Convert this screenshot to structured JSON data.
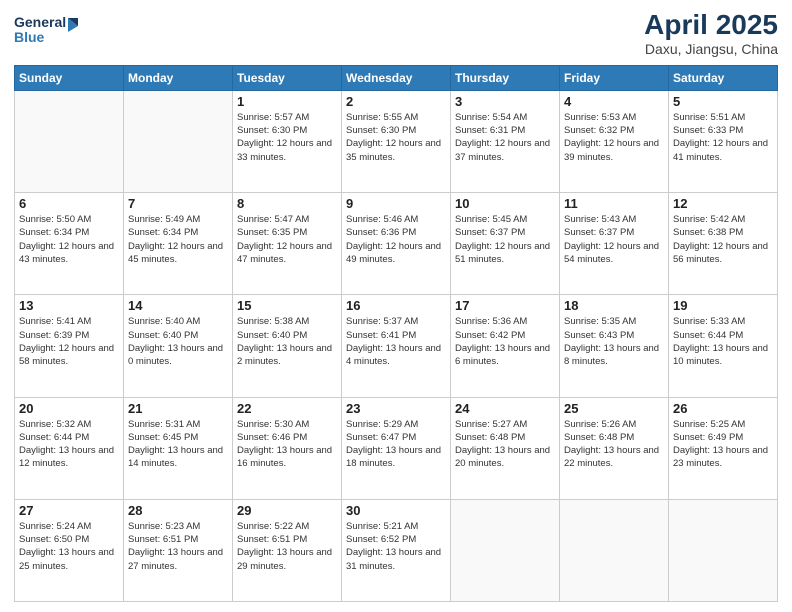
{
  "logo": {
    "line1": "General",
    "line2": "Blue"
  },
  "title": "April 2025",
  "subtitle": "Daxu, Jiangsu, China",
  "days": [
    "Sunday",
    "Monday",
    "Tuesday",
    "Wednesday",
    "Thursday",
    "Friday",
    "Saturday"
  ],
  "weeks": [
    [
      {
        "day": "",
        "sunrise": "",
        "sunset": "",
        "daylight": ""
      },
      {
        "day": "",
        "sunrise": "",
        "sunset": "",
        "daylight": ""
      },
      {
        "day": "1",
        "sunrise": "Sunrise: 5:57 AM",
        "sunset": "Sunset: 6:30 PM",
        "daylight": "Daylight: 12 hours and 33 minutes."
      },
      {
        "day": "2",
        "sunrise": "Sunrise: 5:55 AM",
        "sunset": "Sunset: 6:30 PM",
        "daylight": "Daylight: 12 hours and 35 minutes."
      },
      {
        "day": "3",
        "sunrise": "Sunrise: 5:54 AM",
        "sunset": "Sunset: 6:31 PM",
        "daylight": "Daylight: 12 hours and 37 minutes."
      },
      {
        "day": "4",
        "sunrise": "Sunrise: 5:53 AM",
        "sunset": "Sunset: 6:32 PM",
        "daylight": "Daylight: 12 hours and 39 minutes."
      },
      {
        "day": "5",
        "sunrise": "Sunrise: 5:51 AM",
        "sunset": "Sunset: 6:33 PM",
        "daylight": "Daylight: 12 hours and 41 minutes."
      }
    ],
    [
      {
        "day": "6",
        "sunrise": "Sunrise: 5:50 AM",
        "sunset": "Sunset: 6:34 PM",
        "daylight": "Daylight: 12 hours and 43 minutes."
      },
      {
        "day": "7",
        "sunrise": "Sunrise: 5:49 AM",
        "sunset": "Sunset: 6:34 PM",
        "daylight": "Daylight: 12 hours and 45 minutes."
      },
      {
        "day": "8",
        "sunrise": "Sunrise: 5:47 AM",
        "sunset": "Sunset: 6:35 PM",
        "daylight": "Daylight: 12 hours and 47 minutes."
      },
      {
        "day": "9",
        "sunrise": "Sunrise: 5:46 AM",
        "sunset": "Sunset: 6:36 PM",
        "daylight": "Daylight: 12 hours and 49 minutes."
      },
      {
        "day": "10",
        "sunrise": "Sunrise: 5:45 AM",
        "sunset": "Sunset: 6:37 PM",
        "daylight": "Daylight: 12 hours and 51 minutes."
      },
      {
        "day": "11",
        "sunrise": "Sunrise: 5:43 AM",
        "sunset": "Sunset: 6:37 PM",
        "daylight": "Daylight: 12 hours and 54 minutes."
      },
      {
        "day": "12",
        "sunrise": "Sunrise: 5:42 AM",
        "sunset": "Sunset: 6:38 PM",
        "daylight": "Daylight: 12 hours and 56 minutes."
      }
    ],
    [
      {
        "day": "13",
        "sunrise": "Sunrise: 5:41 AM",
        "sunset": "Sunset: 6:39 PM",
        "daylight": "Daylight: 12 hours and 58 minutes."
      },
      {
        "day": "14",
        "sunrise": "Sunrise: 5:40 AM",
        "sunset": "Sunset: 6:40 PM",
        "daylight": "Daylight: 13 hours and 0 minutes."
      },
      {
        "day": "15",
        "sunrise": "Sunrise: 5:38 AM",
        "sunset": "Sunset: 6:40 PM",
        "daylight": "Daylight: 13 hours and 2 minutes."
      },
      {
        "day": "16",
        "sunrise": "Sunrise: 5:37 AM",
        "sunset": "Sunset: 6:41 PM",
        "daylight": "Daylight: 13 hours and 4 minutes."
      },
      {
        "day": "17",
        "sunrise": "Sunrise: 5:36 AM",
        "sunset": "Sunset: 6:42 PM",
        "daylight": "Daylight: 13 hours and 6 minutes."
      },
      {
        "day": "18",
        "sunrise": "Sunrise: 5:35 AM",
        "sunset": "Sunset: 6:43 PM",
        "daylight": "Daylight: 13 hours and 8 minutes."
      },
      {
        "day": "19",
        "sunrise": "Sunrise: 5:33 AM",
        "sunset": "Sunset: 6:44 PM",
        "daylight": "Daylight: 13 hours and 10 minutes."
      }
    ],
    [
      {
        "day": "20",
        "sunrise": "Sunrise: 5:32 AM",
        "sunset": "Sunset: 6:44 PM",
        "daylight": "Daylight: 13 hours and 12 minutes."
      },
      {
        "day": "21",
        "sunrise": "Sunrise: 5:31 AM",
        "sunset": "Sunset: 6:45 PM",
        "daylight": "Daylight: 13 hours and 14 minutes."
      },
      {
        "day": "22",
        "sunrise": "Sunrise: 5:30 AM",
        "sunset": "Sunset: 6:46 PM",
        "daylight": "Daylight: 13 hours and 16 minutes."
      },
      {
        "day": "23",
        "sunrise": "Sunrise: 5:29 AM",
        "sunset": "Sunset: 6:47 PM",
        "daylight": "Daylight: 13 hours and 18 minutes."
      },
      {
        "day": "24",
        "sunrise": "Sunrise: 5:27 AM",
        "sunset": "Sunset: 6:48 PM",
        "daylight": "Daylight: 13 hours and 20 minutes."
      },
      {
        "day": "25",
        "sunrise": "Sunrise: 5:26 AM",
        "sunset": "Sunset: 6:48 PM",
        "daylight": "Daylight: 13 hours and 22 minutes."
      },
      {
        "day": "26",
        "sunrise": "Sunrise: 5:25 AM",
        "sunset": "Sunset: 6:49 PM",
        "daylight": "Daylight: 13 hours and 23 minutes."
      }
    ],
    [
      {
        "day": "27",
        "sunrise": "Sunrise: 5:24 AM",
        "sunset": "Sunset: 6:50 PM",
        "daylight": "Daylight: 13 hours and 25 minutes."
      },
      {
        "day": "28",
        "sunrise": "Sunrise: 5:23 AM",
        "sunset": "Sunset: 6:51 PM",
        "daylight": "Daylight: 13 hours and 27 minutes."
      },
      {
        "day": "29",
        "sunrise": "Sunrise: 5:22 AM",
        "sunset": "Sunset: 6:51 PM",
        "daylight": "Daylight: 13 hours and 29 minutes."
      },
      {
        "day": "30",
        "sunrise": "Sunrise: 5:21 AM",
        "sunset": "Sunset: 6:52 PM",
        "daylight": "Daylight: 13 hours and 31 minutes."
      },
      {
        "day": "",
        "sunrise": "",
        "sunset": "",
        "daylight": ""
      },
      {
        "day": "",
        "sunrise": "",
        "sunset": "",
        "daylight": ""
      },
      {
        "day": "",
        "sunrise": "",
        "sunset": "",
        "daylight": ""
      }
    ]
  ]
}
